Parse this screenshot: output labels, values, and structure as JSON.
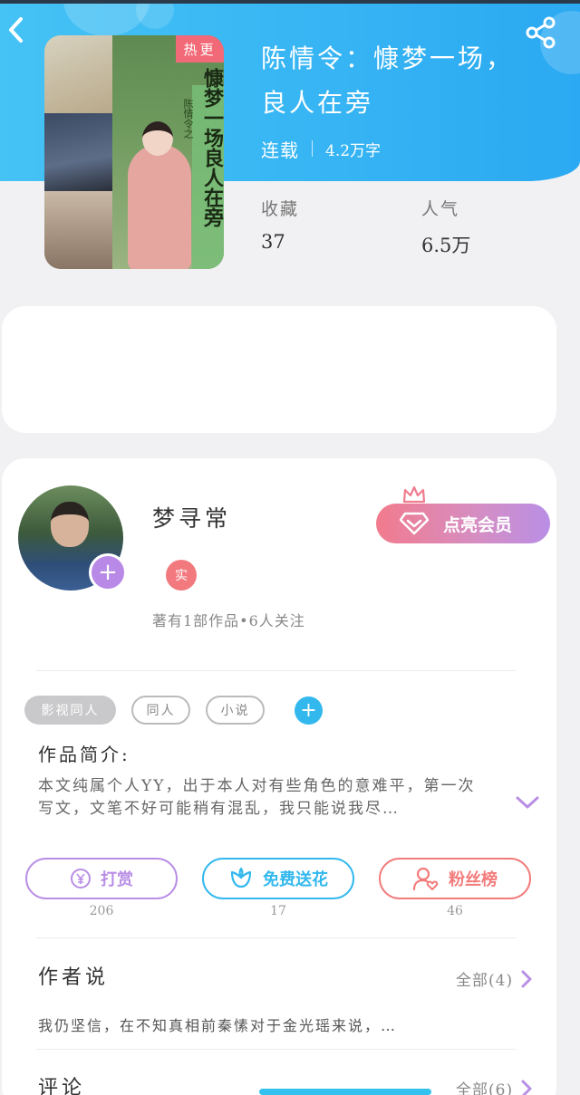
{
  "header": {
    "back_icon": "chevron-left-icon",
    "share_icon": "share-icon"
  },
  "book": {
    "cover_tag": "热更",
    "cover_vertical_title": "慷梦一场良人在旁",
    "cover_vertical_sub": "陈情令之",
    "title": "陈情令：慷梦一场，良人在旁",
    "status": "连载",
    "word_count": "4.2万字",
    "stats": [
      {
        "label": "收藏",
        "value": "37"
      },
      {
        "label": "人气",
        "value": "6.5万"
      }
    ]
  },
  "author": {
    "name": "梦寻常",
    "badge": "实",
    "summary": "著有1部作品•6人关注",
    "follow_icon": "plus-icon"
  },
  "vip": {
    "label": "点亮会员",
    "icon": "diamond-icon",
    "crown_icon": "crown-icon"
  },
  "tags": [
    {
      "label": "影视同人",
      "style": "filled"
    },
    {
      "label": "同人",
      "style": "outline"
    },
    {
      "label": "小说",
      "style": "outline"
    }
  ],
  "intro": {
    "title": "作品简介:",
    "text": "本文纯属个人YY，出于本人对有些角色的意难平，第一次写文，文笔不好可能稍有混乱，我只能说我尽…"
  },
  "actions": [
    {
      "label": "打赏",
      "count": "206",
      "icon": "yen-icon",
      "color": "#b98ee5"
    },
    {
      "label": "免费送花",
      "count": "17",
      "icon": "flower-icon",
      "color": "#33b8ee"
    },
    {
      "label": "粉丝榜",
      "count": "46",
      "icon": "user-heart-icon",
      "color": "#f27b7b"
    }
  ],
  "author_say": {
    "title": "作者说",
    "all_label": "全部(4)",
    "text": "我仍坚信，在不知真相前秦愫对于金光瑶来说，…"
  },
  "comments": {
    "title": "评论",
    "all_label": "全部(6)"
  },
  "colors": {
    "hero_start": "#45c3f5",
    "hero_end": "#2ba9f2",
    "accent_purple": "#b98ee5",
    "accent_pink": "#f27b8d"
  }
}
